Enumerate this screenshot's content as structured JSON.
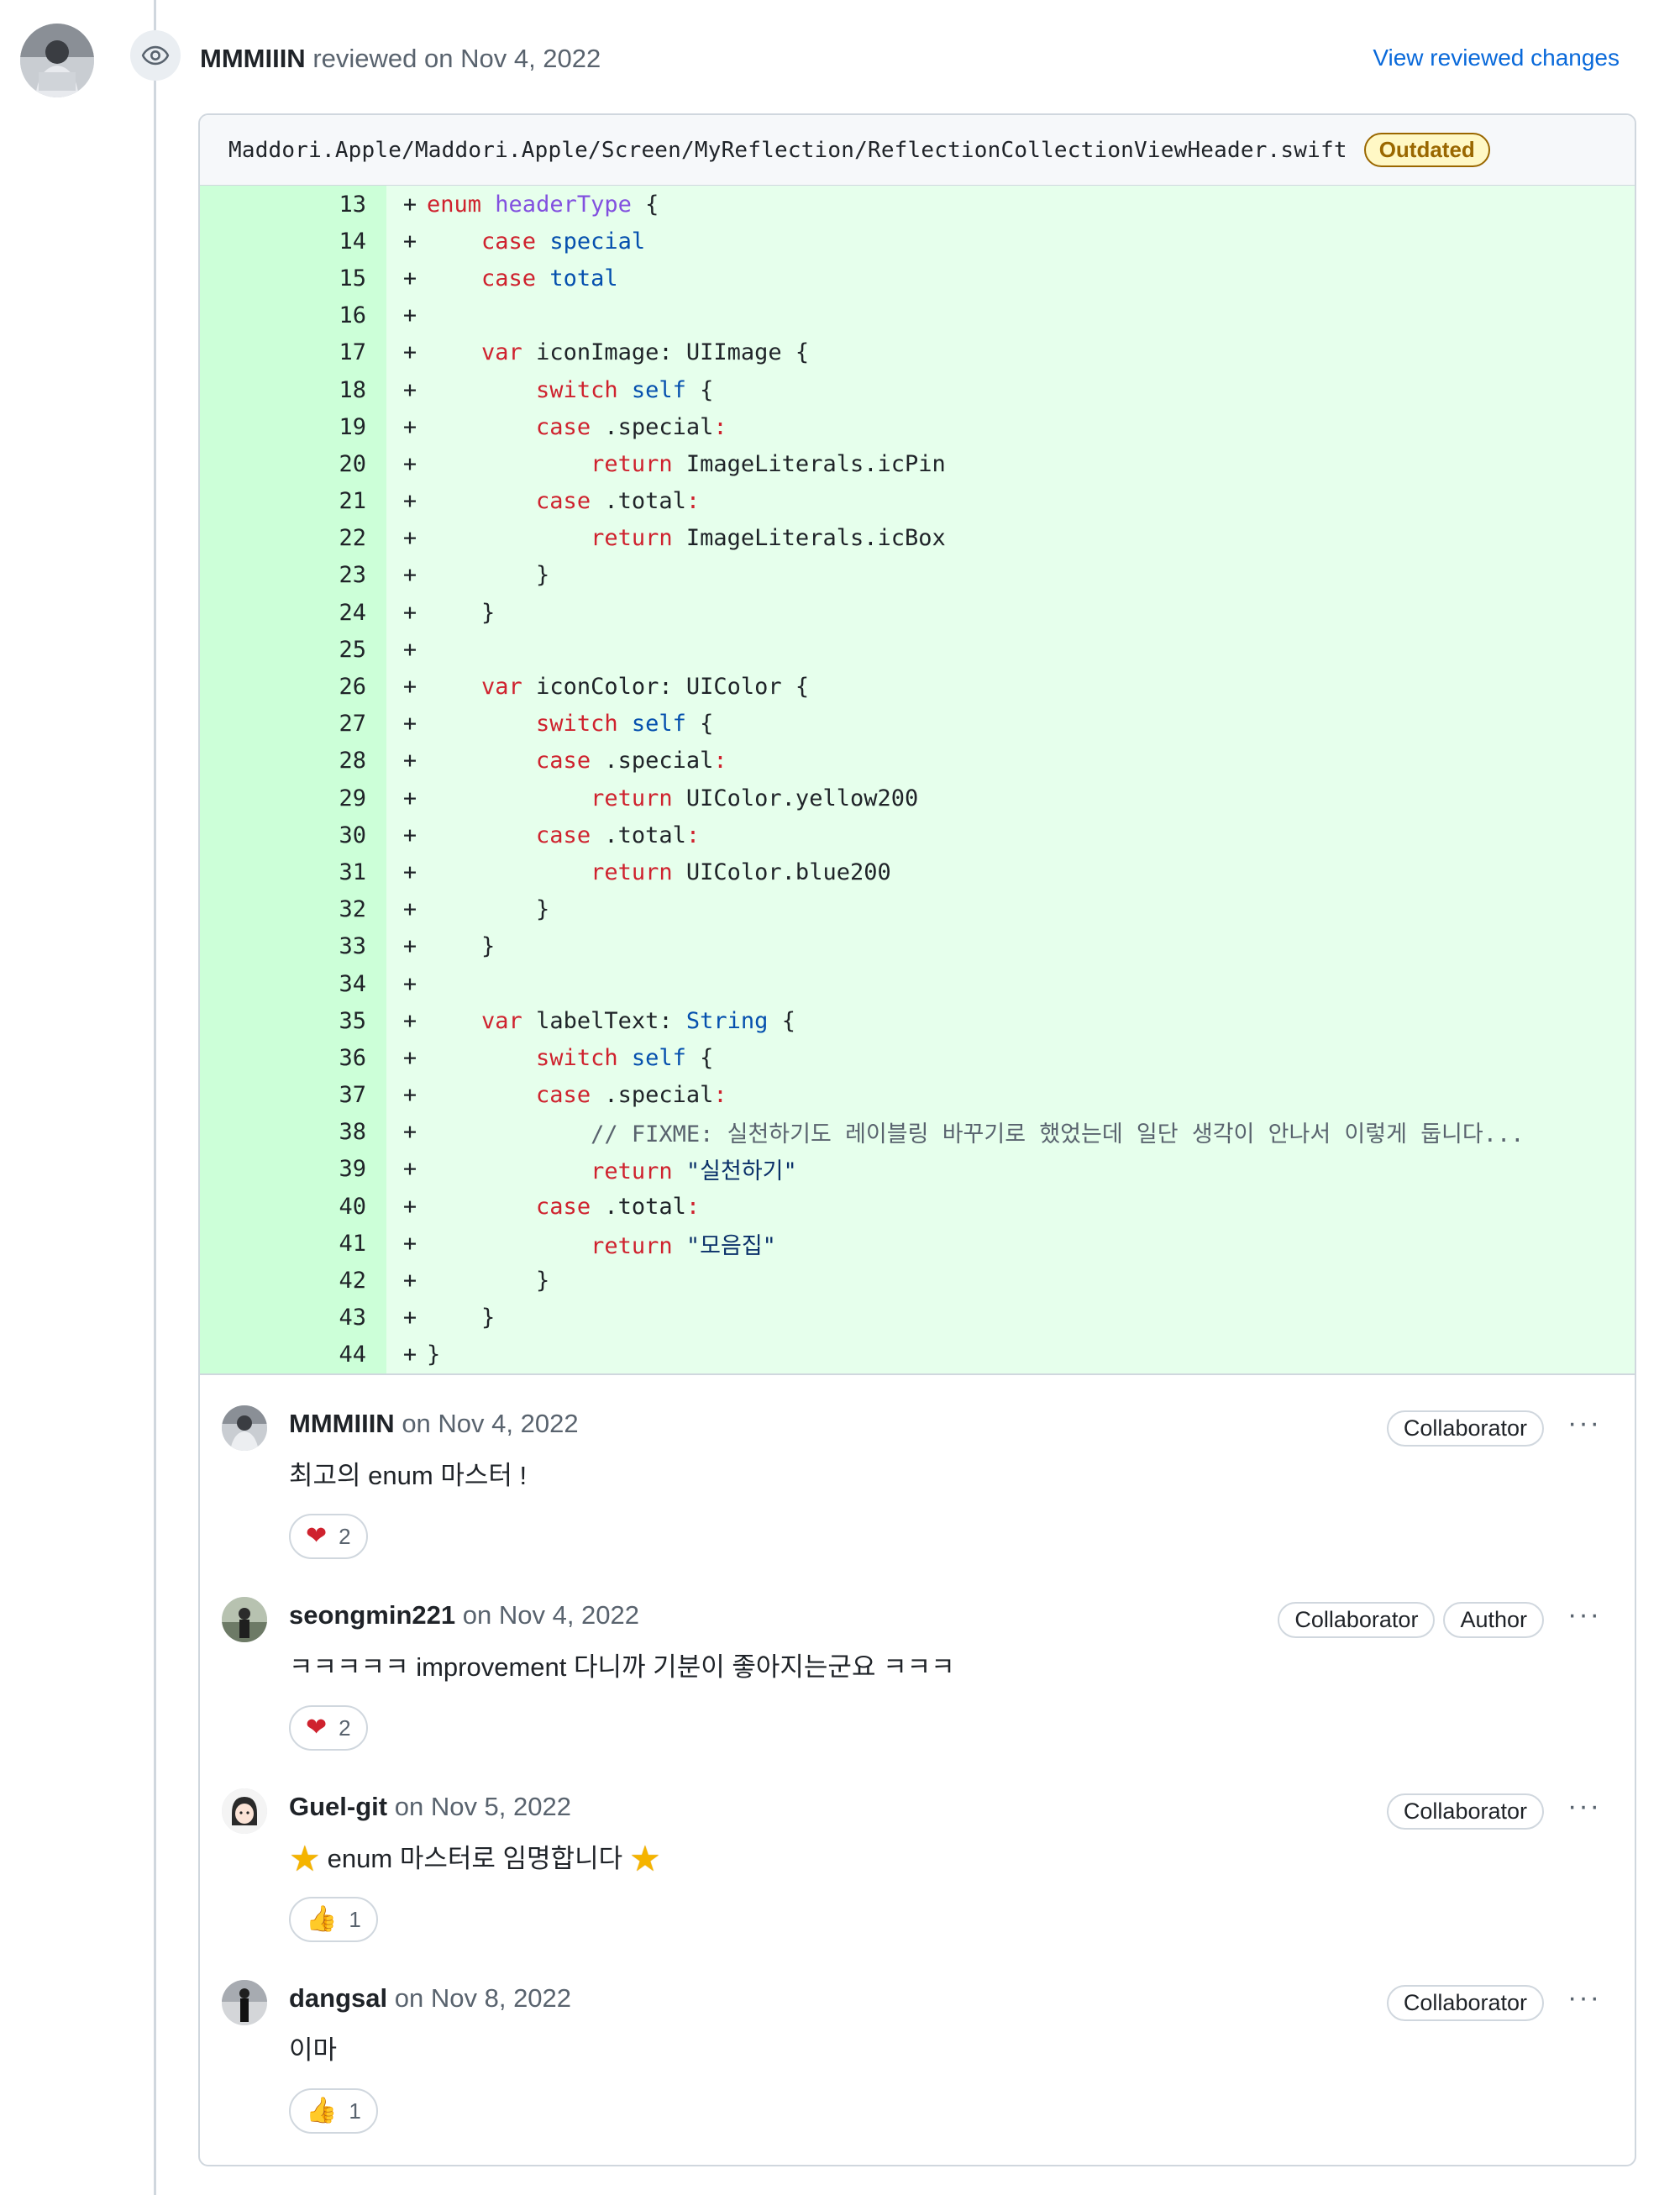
{
  "review": {
    "author": "MMMIIIN",
    "action_text": " reviewed on Nov 4, 2022",
    "view_changes_label": "View reviewed changes"
  },
  "thread": {
    "file_path": "Maddori.Apple/Maddori.Apple/Screen/MyReflection/ReflectionCollectionViewHeader.swift",
    "status_badge": "Outdated"
  },
  "code_lines": [
    {
      "n": "13"
    },
    {
      "n": "14"
    },
    {
      "n": "15"
    },
    {
      "n": "16"
    },
    {
      "n": "17"
    },
    {
      "n": "18"
    },
    {
      "n": "19"
    },
    {
      "n": "20"
    },
    {
      "n": "21"
    },
    {
      "n": "22"
    },
    {
      "n": "23"
    },
    {
      "n": "24"
    },
    {
      "n": "25"
    },
    {
      "n": "26"
    },
    {
      "n": "27"
    },
    {
      "n": "28"
    },
    {
      "n": "29"
    },
    {
      "n": "30"
    },
    {
      "n": "31"
    },
    {
      "n": "32"
    },
    {
      "n": "33"
    },
    {
      "n": "34"
    },
    {
      "n": "35"
    },
    {
      "n": "36"
    },
    {
      "n": "37"
    },
    {
      "n": "38"
    },
    {
      "n": "39"
    },
    {
      "n": "40"
    },
    {
      "n": "41"
    },
    {
      "n": "42"
    },
    {
      "n": "43"
    },
    {
      "n": "44"
    }
  ],
  "code": {
    "plus": "+",
    "l13": [
      "enum",
      "headerType",
      "{"
    ],
    "l14": [
      "case",
      "special"
    ],
    "l15": [
      "case",
      "total"
    ],
    "l17": [
      "var",
      "iconImage: UIImage {"
    ],
    "l18": [
      "switch",
      "self",
      "{"
    ],
    "l19": [
      "case",
      ".special",
      ":"
    ],
    "l20": [
      "return",
      "ImageLiterals.icPin"
    ],
    "l21": [
      "case",
      ".total",
      ":"
    ],
    "l22": [
      "return",
      "ImageLiterals.icBox"
    ],
    "l23": [
      "}"
    ],
    "l24": [
      "}"
    ],
    "l26": [
      "var",
      "iconColor: UIColor {"
    ],
    "l27": [
      "switch",
      "self",
      "{"
    ],
    "l28": [
      "case",
      ".special",
      ":"
    ],
    "l29": [
      "return",
      "UIColor.yellow200"
    ],
    "l30": [
      "case",
      ".total",
      ":"
    ],
    "l31": [
      "return",
      "UIColor.blue200"
    ],
    "l32": [
      "}"
    ],
    "l33": [
      "}"
    ],
    "l35": [
      "var",
      "labelText: ",
      "String",
      " {"
    ],
    "l36": [
      "switch",
      "self",
      "{"
    ],
    "l37": [
      "case",
      ".special",
      ":"
    ],
    "l38": [
      "// FIXME: 실천하기도 레이블링 바꾸기로 했었는데 일단 생각이 안나서 이렇게 둡니다..."
    ],
    "l39": [
      "return",
      "\"실천하기\""
    ],
    "l40": [
      "case",
      ".total",
      ":"
    ],
    "l41": [
      "return",
      "\"모음집\""
    ],
    "l42": [
      "}"
    ],
    "l43": [
      "}"
    ],
    "l44": [
      "}"
    ]
  },
  "comments": [
    {
      "author": "MMMIIIN",
      "date": " on Nov 4, 2022",
      "badges": [
        "Collaborator"
      ],
      "body": "최고의 enum 마스터 !",
      "reaction_icon": "heart-icon",
      "reaction_count": "2"
    },
    {
      "author": "seongmin221",
      "date": " on Nov 4, 2022",
      "badges": [
        "Collaborator",
        "Author"
      ],
      "body": "ㅋㅋㅋㅋㅋ improvement 다니까 기분이 좋아지는군요 ㅋㅋㅋ",
      "reaction_icon": "heart-icon",
      "reaction_count": "2"
    },
    {
      "author": "Guel-git",
      "date": " on Nov 5, 2022",
      "badges": [
        "Collaborator"
      ],
      "body": "enum 마스터로 임명합니다",
      "reaction_icon": "thumbs-up-icon",
      "reaction_count": "1"
    },
    {
      "author": "dangsal",
      "date": " on Nov 8, 2022",
      "badges": [
        "Collaborator"
      ],
      "body": "이마",
      "reaction_icon": "thumbs-up-icon",
      "reaction_count": "1"
    }
  ],
  "colors": {
    "link": "#0969da",
    "added_line_bg": "#e6ffec",
    "added_gutter_bg": "#ccffd8",
    "keyword": "#cf222e",
    "outdated": "#9a6700"
  }
}
